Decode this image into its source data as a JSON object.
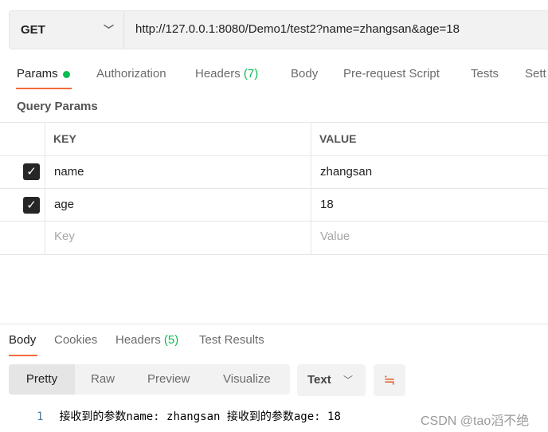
{
  "request": {
    "method": "GET",
    "url": "http://127.0.0.1:8080/Demo1/test2?name=zhangsan&age=18"
  },
  "tabs": [
    {
      "label": "Params"
    },
    {
      "label": "Authorization"
    },
    {
      "label": "Headers",
      "count": "(7)"
    },
    {
      "label": "Body"
    },
    {
      "label": "Pre-request Script"
    },
    {
      "label": "Tests"
    },
    {
      "label": "Sett"
    }
  ],
  "query_params": {
    "title": "Query Params",
    "headers": [
      "KEY",
      "VALUE"
    ],
    "rows": [
      {
        "key": "name",
        "value": "zhangsan",
        "checked": true
      },
      {
        "key": "age",
        "value": "18",
        "checked": true
      }
    ],
    "placeholder": {
      "key": "Key",
      "value": "Value"
    }
  },
  "response": {
    "tabs": [
      {
        "label": "Body"
      },
      {
        "label": "Cookies"
      },
      {
        "label": "Headers",
        "count": "(5)"
      },
      {
        "label": "Test Results"
      }
    ],
    "views": [
      "Pretty",
      "Raw",
      "Preview",
      "Visualize"
    ],
    "format": "Text",
    "line_number": "1",
    "body": "接收到的参数name: zhangsan  接收到的参数age: 18"
  },
  "watermark": "CSDN @tao滔不绝",
  "colors": {
    "accent": "#f26b3a",
    "green": "#0cbb52"
  }
}
